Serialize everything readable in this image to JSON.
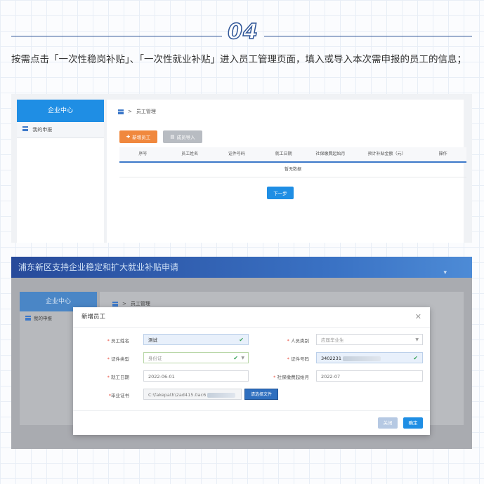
{
  "step": {
    "number": "04"
  },
  "intro": "按需点击「一次性稳岗补贴」、「一次性就业补贴」进入员工管理页面，填入或导入本次需申报的员工的信息；",
  "shot1": {
    "brand": "企业中心",
    "sidebar_item": "我的申报",
    "breadcrumb_sep": ">",
    "breadcrumb": "员工管理",
    "add_button": "新增员工",
    "import_button": "成员导入",
    "columns": [
      "序号",
      "员工姓名",
      "证件号码",
      "就工日期",
      "社保缴费起始月",
      "预计补贴金额（元）",
      "操作"
    ],
    "empty_text": "暂无数据",
    "next_button": "下一步"
  },
  "shot2": {
    "banner_title": "浦东新区支持企业稳定和扩大就业补贴申请",
    "brand": "企业中心",
    "sidebar_item": "我的申报",
    "breadcrumb_sep": ">",
    "breadcrumb": "员工管理",
    "modal": {
      "title": "新增员工",
      "name_label": "员工姓名",
      "name_value": "测试",
      "category_label": "人员类别",
      "category_value": "应届毕业生",
      "idtype_label": "证件类型",
      "idtype_value": "身份证",
      "idnum_label": "证件号码",
      "idnum_value": "3402231",
      "workdate_label": "就工日期",
      "workdate_value": "2022-06-01",
      "social_label": "社保缴费起始月",
      "social_value": "2022-07",
      "cert_label": "毕业证书",
      "cert_value": "C:\\fakepath\\2ad415.0ac6",
      "cert_button": "请选择文件",
      "cancel_button": "关闭",
      "ok_button": "确定"
    }
  },
  "colors": {
    "accent": "#1f8ee4",
    "orange": "#f0883e",
    "navy": "#2f5597"
  }
}
